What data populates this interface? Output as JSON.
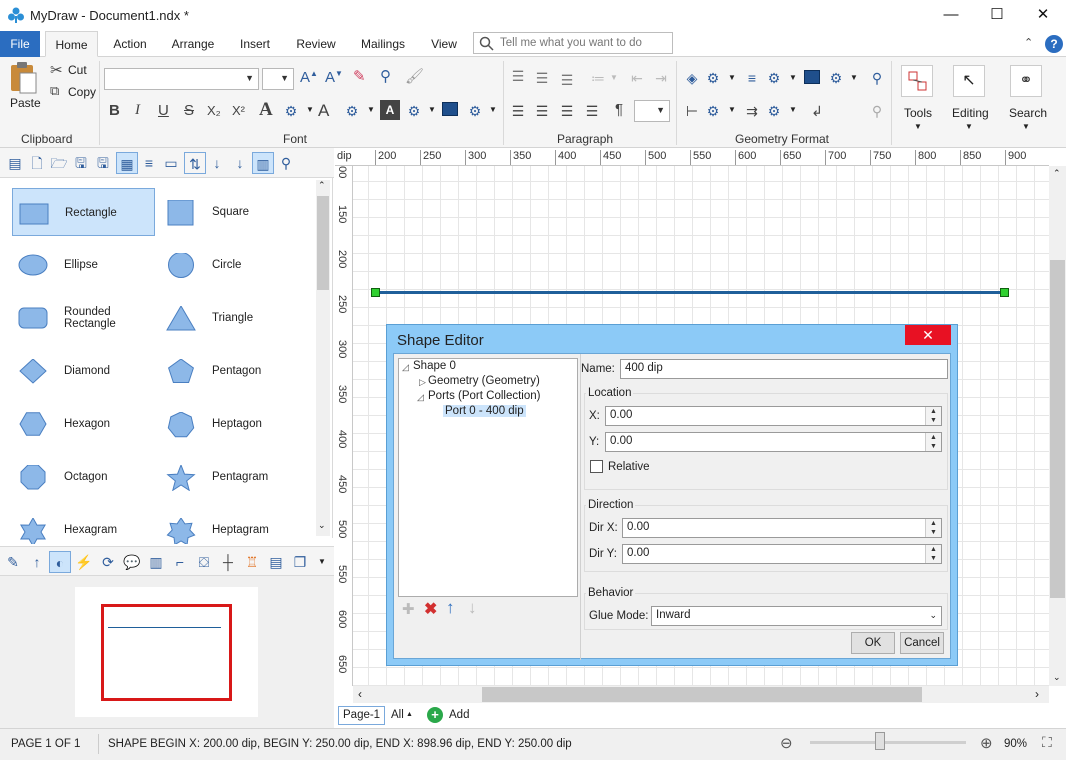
{
  "window": {
    "title": "MyDraw - Document1.ndx *",
    "minimize": "—",
    "maximize": "☐",
    "close": "✕"
  },
  "ribbon": {
    "tabs": [
      "File",
      "Home",
      "Action",
      "Arrange",
      "Insert",
      "Review",
      "Mailings",
      "View"
    ],
    "active_tab": "Home",
    "tell_me_placeholder": "Tell me what you want to do",
    "clipboard": {
      "paste": "Paste",
      "cut": "Cut",
      "copy": "Copy",
      "group": "Clipboard"
    },
    "font": {
      "group": "Font",
      "bold": "B",
      "italic": "I",
      "underline": "U",
      "strike": "S",
      "sub": "X₂",
      "sup": "X²"
    },
    "paragraph": {
      "group": "Paragraph",
      "pilcrow": "¶"
    },
    "geometry_format": {
      "group": "Geometry Format"
    },
    "tools": "Tools",
    "editing": "Editing",
    "search": "Search"
  },
  "shapes": [
    {
      "label": "Rectangle",
      "shape": "rect",
      "selected": true
    },
    {
      "label": "Square",
      "shape": "square"
    },
    {
      "label": "Ellipse",
      "shape": "ellipse"
    },
    {
      "label": "Circle",
      "shape": "circle"
    },
    {
      "label": "Rounded Rectangle",
      "shape": "rrect"
    },
    {
      "label": "Triangle",
      "shape": "triangle"
    },
    {
      "label": "Diamond",
      "shape": "diamond"
    },
    {
      "label": "Pentagon",
      "shape": "pentagon"
    },
    {
      "label": "Hexagon",
      "shape": "hexagon"
    },
    {
      "label": "Heptagon",
      "shape": "heptagon"
    },
    {
      "label": "Octagon",
      "shape": "octagon"
    },
    {
      "label": "Pentagram",
      "shape": "pentagram"
    },
    {
      "label": "Hexagram",
      "shape": "hexagram"
    },
    {
      "label": "Heptagram",
      "shape": "heptagram"
    }
  ],
  "ruler": {
    "unit": "dip",
    "h_labels": [
      "200",
      "250",
      "300",
      "350",
      "400",
      "450",
      "500",
      "550",
      "600",
      "650",
      "700",
      "750",
      "800",
      "850",
      "900"
    ],
    "v_labels": [
      "100",
      "150",
      "200",
      "250",
      "300",
      "350",
      "400",
      "450",
      "500",
      "550",
      "600",
      "650"
    ]
  },
  "dialog": {
    "title": "Shape Editor",
    "tree": {
      "root": "Shape 0",
      "geometry": "Geometry (Geometry)",
      "ports": "Ports (Port Collection)",
      "port0": "Port 0 - 400 dip"
    },
    "name_label": "Name:",
    "name_value": "400 dip",
    "location_group": "Location",
    "x_label": "X:",
    "x_value": "0.00",
    "y_label": "Y:",
    "y_value": "0.00",
    "relative_label": "Relative",
    "relative_checked": false,
    "direction_group": "Direction",
    "dirx_label": "Dir X:",
    "dirx_value": "0.00",
    "diry_label": "Dir Y:",
    "diry_value": "0.00",
    "behavior_group": "Behavior",
    "glue_label": "Glue Mode:",
    "glue_value": "Inward",
    "ok": "OK",
    "cancel": "Cancel"
  },
  "pages": {
    "current": "Page-1",
    "all": "All",
    "add": "Add"
  },
  "status": {
    "page": "PAGE 1 OF 1",
    "info": "SHAPE BEGIN X: 200.00 dip, BEGIN Y: 250.00 dip, END X: 898.96 dip, END Y: 250.00 dip",
    "zoom": "90%",
    "zoom_level": 0.45
  },
  "colors": {
    "accent": "#2b6dc0",
    "shape_fill": "#8db8e8",
    "shape_stroke": "#4a7fc1",
    "dialog_frame": "#8ccaf7",
    "line": "#1f5f9a"
  }
}
